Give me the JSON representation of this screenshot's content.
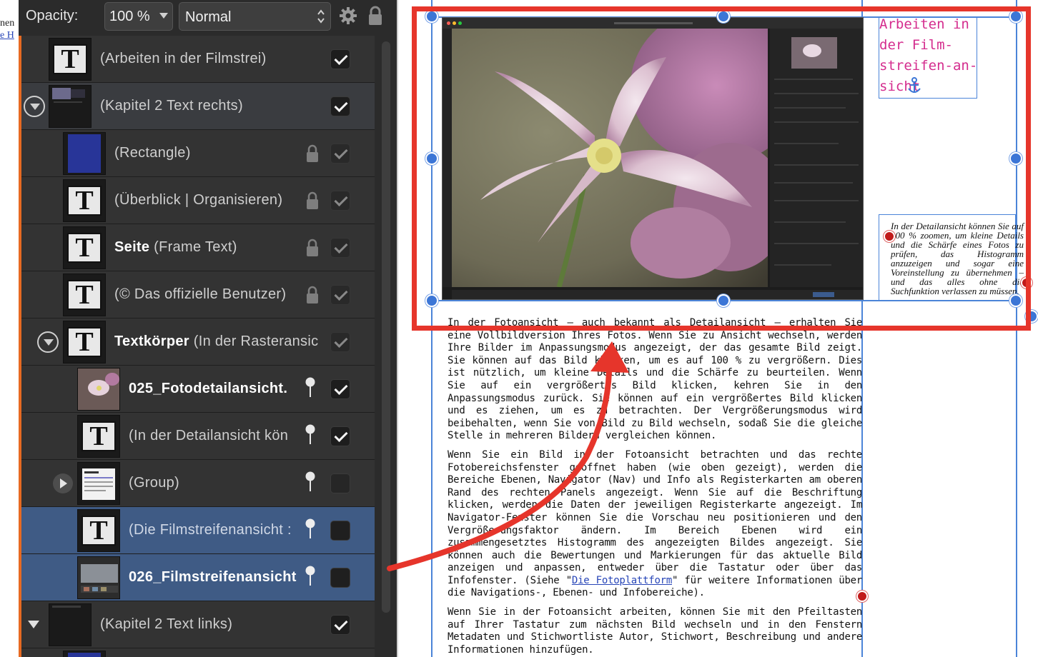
{
  "doc_edge": {
    "fragment_1": "nen",
    "fragment_2": "e H"
  },
  "toolbar": {
    "opacity_label": "Opacity:",
    "opacity_value": "100 %",
    "blend_mode": "Normal",
    "gear_icon": "gear-icon",
    "lock_icon": "lock-icon"
  },
  "layers": [
    {
      "name": "(Arbeiten in der Filmstrei)",
      "thumb": "text-icon",
      "checked": true
    },
    {
      "name": "(Kapitel 2 Text rechts)",
      "thumb": "page-thumbnail",
      "checked": true,
      "expanded": true
    },
    {
      "name": "(Rectangle)",
      "thumb": "blue-rectangle",
      "locked": true,
      "checked": true
    },
    {
      "name": "(Überblick | Organisieren)",
      "thumb": "text-icon",
      "locked": true,
      "checked": true
    },
    {
      "bold": "Seite",
      "name": " (Frame Text)",
      "thumb": "text-icon",
      "locked": true,
      "checked": true
    },
    {
      "name": "(© Das offizielle Benutzer)",
      "thumb": "text-icon",
      "locked": true,
      "checked": true
    },
    {
      "bold": "Textkörper",
      "name": " (In der Rasteransic",
      "thumb": "text-icon",
      "checked": true,
      "expanded": true
    },
    {
      "name": "025_Fotodetailansicht.",
      "thumb": "flower-image",
      "pinned": true,
      "checked": true
    },
    {
      "name": "(In der Detailansicht kön",
      "thumb": "text-icon",
      "pinned": true,
      "checked": true
    },
    {
      "name": "(Group)",
      "thumb": "group-thumbnail",
      "pinned": true,
      "checked": false,
      "collapsed": true
    },
    {
      "name": "(Die Filmstreifenansicht :",
      "thumb": "text-icon",
      "pinned": true,
      "checked": false,
      "selected": true
    },
    {
      "name": "026_Filmstreifenansicht",
      "thumb": "filmstrip-image",
      "pinned": true,
      "checked": false,
      "selected": true
    },
    {
      "name": "(Kapitel 2 Text links)",
      "thumb": "page-thumbnail",
      "checked": true,
      "expanded": true
    }
  ],
  "canvas": {
    "heading": "Arbeiten in der Film-streifen-an-sicht",
    "caption": "In der Detailansicht können Sie auf 100 % zoomen, um kleine Details und die Schärfe eines Fotos zu prüfen, das Histogramm anzuzeigen und sogar eine Voreinstellung zu übernehmen – und das alles ohne die Suchfunktion verlassen zu müssen.",
    "body_p1": "In der Fotoansicht – auch bekannt als Detailansicht – erhalten Sie eine Vollbildversion Ihres Fotos. Wenn Sie zu Ansicht wechseln, werden Ihre Bilder im Anpassungsmodus angezeigt, der das gesamte Bild zeigt. Sie können auf das Bild klicken, um es auf 100 % zu vergrößern. Dies ist nützlich, um kleine Details und die Schärfe zu beurteilen. Wenn Sie auf ein vergrößertes Bild klicken, kehren Sie in den Anpassungsmodus zurück. Sie können auf ein vergrößertes Bild klicken und es ziehen, um es zu betrachten. Der Vergrößerungsmodus wird beibehalten, wenn Sie von Bild zu Bild wechseln, sodaß Sie die gleiche Stelle in mehreren Bildern vergleichen können.",
    "body_p2_a": "Wenn Sie ein Bild in der Fotoansicht betrachten und das rechte Fotobereichsfenster geöffnet haben (wie oben gezeigt), werden die Bereiche Ebenen, Navigator (Nav) und Info als Registerkarten am oberen Rand des rechten Panels angezeigt. Wenn Sie auf die Beschriftung klicken, werden die Daten der jeweiligen Registerkarte angezeigt. Im Navigator-Fenster können Sie die Vorschau neu positionieren und den Vergrößerungsfaktor ändern. Im Bereich Ebenen wird ein zusammengesetztes Histogramm des angezeigten Bildes angezeigt. Sie können auch die Bewertungen und Markierungen für das aktuelle Bild anzeigen und anpassen, entweder über die Tastatur oder über das Infofenster. (Siehe \"",
    "body_p2_link": "Die Fotoplattform",
    "body_p2_b": "\" für weitere Informationen über die Navigations-, Ebenen- und Infobereiche).",
    "body_p3": "Wenn Sie in der Fotoansicht arbeiten, können Sie mit den Pfeiltasten auf Ihrer Tastatur zum nächsten Bild wechseln und in den Fenstern Metadaten und Stichwortliste Autor, Stichwort, Beschreibung und andere Informationen hinzufügen."
  },
  "annotation": {
    "highlight_color": "#e6352b",
    "arrow_color": "#e6352b"
  },
  "colors": {
    "selection": "#3f5b85",
    "guide": "#4b84d8",
    "heading": "#d42d8e",
    "accent_orange": "#e76a22"
  }
}
